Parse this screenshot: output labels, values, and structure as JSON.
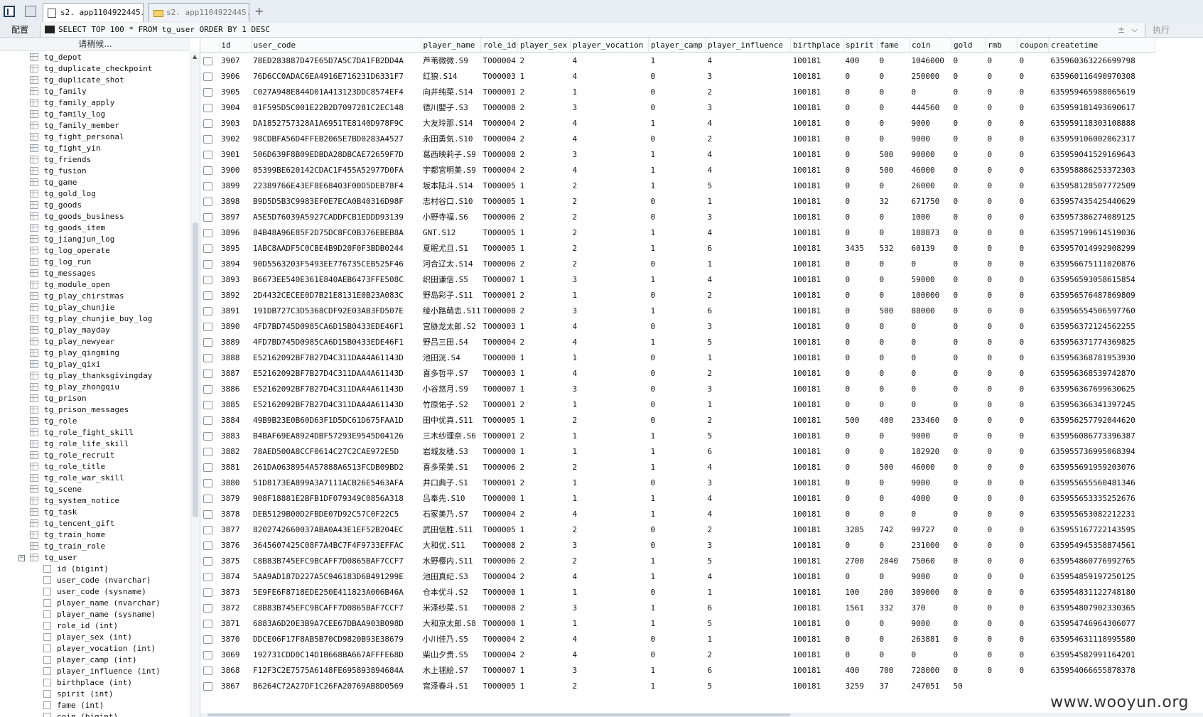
{
  "tabs": [
    {
      "label": "s2. app1104922445. ..."
    },
    {
      "label": "s2. app1104922445. ..."
    }
  ],
  "toolbar": {
    "config_label": "配置",
    "exec_label": "执行",
    "query": "SELECT TOP 100 * FROM tg_user ORDER BY 1 DESC",
    "right_symbol": "±"
  },
  "sidebar": {
    "header": "请稍候...",
    "tables": [
      "tg_depot",
      "tg_duplicate_checkpoint",
      "tg_duplicate_shot",
      "tg_family",
      "tg_family_apply",
      "tg_family_log",
      "tg_family_member",
      "tg_fight_personal",
      "tg_fight_yin",
      "tg_friends",
      "tg_fusion",
      "tg_game",
      "tg_gold_log",
      "tg_goods",
      "tg_goods_business",
      "tg_goods_item",
      "tg_jiangjun_log",
      "tg_log_operate",
      "tg_log_run",
      "tg_messages",
      "tg_module_open",
      "tg_play_chirstmas",
      "tg_play_chunjie",
      "tg_play_chunjie_buy_log",
      "tg_play_mayday",
      "tg_play_newyear",
      "tg_play_qingming",
      "tg_play_qixi",
      "tg_play_thanksgivingday",
      "tg_play_zhongqiu",
      "tg_prison",
      "tg_prison_messages",
      "tg_role",
      "tg_role_fight_skill",
      "tg_role_life_skill",
      "tg_role_recruit",
      "tg_role_title",
      "tg_role_war_skill",
      "tg_scene",
      "tg_system_notice",
      "tg_task",
      "tg_tencent_gift",
      "tg_train_home",
      "tg_train_role"
    ],
    "expanded_table": "tg_user",
    "expander": "−",
    "columns": [
      "id (bigint)",
      "user_code (nvarchar)",
      "user_code (sysname)",
      "player_name (nvarchar)",
      "player_name (sysname)",
      "role_id (int)",
      "player_sex (int)",
      "player_vocation (int)",
      "player_camp (int)",
      "player_influence (int)",
      "birthplace (int)",
      "spirit (int)",
      "fame (int)",
      "coin (bigint)"
    ]
  },
  "grid": {
    "headers": [
      "id",
      "user_code",
      "player_name",
      "role_id",
      "player_sex",
      "player_vocation",
      "player_camp",
      "player_influence",
      "birthplace",
      "spirit",
      "fame",
      "coin",
      "gold",
      "rmb",
      "coupon",
      "createtime"
    ],
    "rows": [
      [
        "3907",
        "78ED283887D47E65D7A5C7DA1FB2DD4A",
        "芦苇微微.S9",
        "T000004",
        "2",
        "4",
        "1",
        "4",
        "100181",
        "400",
        "0",
        "1046000",
        "0",
        "0",
        "0",
        "635960363226699798"
      ],
      [
        "3906",
        "76D6CC0ADAC6EA4916E716231D6331F7",
        "红狼.S14",
        "T000003",
        "1",
        "4",
        "0",
        "3",
        "100181",
        "0",
        "0",
        "250000",
        "0",
        "0",
        "0",
        "635960116490970308"
      ],
      [
        "3905",
        "C027A948E844D01A413123DDC8574EF4",
        "向井纯菜.S14",
        "T000001",
        "2",
        "1",
        "0",
        "2",
        "100181",
        "0",
        "0",
        "0",
        "0",
        "0",
        "0",
        "635959465988065619"
      ],
      [
        "3904",
        "01F595D5C001E22B2D7097281C2EC148",
        "德川嬰子.S3",
        "T000008",
        "2",
        "3",
        "0",
        "3",
        "100181",
        "0",
        "0",
        "444560",
        "0",
        "0",
        "0",
        "635959181493690617"
      ],
      [
        "3903",
        "DA1852757328A1A6951TE8140D978F9C",
        "大友玲那.S14",
        "T000004",
        "2",
        "4",
        "1",
        "4",
        "100181",
        "0",
        "0",
        "9000",
        "0",
        "0",
        "0",
        "635959118303108888"
      ],
      [
        "3902",
        "98CDBFA56D4FFEB2065E7BD0283A4527",
        "永田勇気.S10",
        "T000004",
        "2",
        "4",
        "0",
        "2",
        "100181",
        "0",
        "0",
        "9000",
        "0",
        "0",
        "0",
        "635959106002062317"
      ],
      [
        "3901",
        "506D639F8B09EDBDA28DBCAE72659F7D",
        "葛西映莉子.S9",
        "T000008",
        "2",
        "3",
        "1",
        "4",
        "100181",
        "0",
        "500",
        "90000",
        "0",
        "0",
        "0",
        "635959041529169643"
      ],
      [
        "3900",
        "05399BE620142CDAC1F455A52977D0FA",
        "宇都宮明美.S9",
        "T000004",
        "2",
        "4",
        "1",
        "4",
        "100181",
        "0",
        "500",
        "46000",
        "0",
        "0",
        "0",
        "635958886253372303"
      ],
      [
        "3899",
        "22389766E43EF8E68403F00D5DEB78F4",
        "坂本陆斗.S14",
        "T000005",
        "1",
        "2",
        "1",
        "5",
        "100181",
        "0",
        "0",
        "26000",
        "0",
        "0",
        "0",
        "635958128507772509"
      ],
      [
        "3898",
        "B9D5D5B3C9983EF0E7ECA0B40316D98F",
        "志村谷口.S10",
        "T000005",
        "1",
        "2",
        "0",
        "1",
        "100181",
        "0",
        "32",
        "671750",
        "0",
        "0",
        "0",
        "635957435425440629"
      ],
      [
        "3897",
        "A5E5D76039A5927CADDFCB1EDDD93139",
        "小野寺福.S6",
        "T000006",
        "2",
        "2",
        "0",
        "3",
        "100181",
        "0",
        "0",
        "1000",
        "0",
        "0",
        "0",
        "635957386274089125"
      ],
      [
        "3896",
        "84B48A96E85F2D75DC8FC0B376EBEB8A",
        "GNT.S12",
        "T000005",
        "1",
        "2",
        "1",
        "4",
        "100181",
        "0",
        "0",
        "188873",
        "0",
        "0",
        "0",
        "635957199614519036"
      ],
      [
        "3895",
        "1ABC8AADF5C0CBE4B9D20F0F3BDB0244",
        "夏眠尤且.S1",
        "T000005",
        "1",
        "2",
        "1",
        "6",
        "100181",
        "3435",
        "532",
        "60139",
        "0",
        "0",
        "0",
        "635957014992908299"
      ],
      [
        "3894",
        "90D5563203F5493EE776735CEB525F46",
        "河合辽太.S14",
        "T000006",
        "2",
        "2",
        "0",
        "1",
        "100181",
        "0",
        "0",
        "0",
        "0",
        "0",
        "0",
        "635956675111020876"
      ],
      [
        "3893",
        "B6673EE540E361E840AEB6473FFE508C",
        "织田谦信.S5",
        "T000007",
        "1",
        "3",
        "1",
        "4",
        "100181",
        "0",
        "0",
        "59000",
        "0",
        "0",
        "0",
        "635956593058615854"
      ],
      [
        "3892",
        "2D4432CECEE0D7B21E8131E0B23A083C",
        "野岛彩子.S11",
        "T000001",
        "2",
        "1",
        "0",
        "2",
        "100181",
        "0",
        "0",
        "100000",
        "0",
        "0",
        "0",
        "635956576487869809"
      ],
      [
        "3891",
        "191DB727C3D5368CDF92E03AB3FD507E",
        "绫小路萌恋.S11",
        "T000008",
        "2",
        "3",
        "1",
        "6",
        "100181",
        "0",
        "500",
        "88000",
        "0",
        "0",
        "0",
        "635956554506597760"
      ],
      [
        "3890",
        "4FD7BD745D0985CA6D15B0433EDE46F1",
        "宫胁龙太郎.S2",
        "T000003",
        "1",
        "4",
        "0",
        "3",
        "100181",
        "0",
        "0",
        "0",
        "0",
        "0",
        "0",
        "635956372124562255"
      ],
      [
        "3889",
        "4FD7BD745D0985CA6D15B0433EDE46F1",
        "野吕三田.S4",
        "T000004",
        "2",
        "4",
        "1",
        "5",
        "100181",
        "0",
        "0",
        "0",
        "0",
        "0",
        "0",
        "635956371774369825"
      ],
      [
        "3888",
        "E52162092BF7B27D4C311DAA4A61143D",
        "池田洸.S4",
        "T000000",
        "1",
        "1",
        "0",
        "1",
        "100181",
        "0",
        "0",
        "0",
        "0",
        "0",
        "0",
        "635956368781953930"
      ],
      [
        "3887",
        "E52162092BF7B27D4C311DAA4A61143D",
        "喜多哲平.S7",
        "T000003",
        "1",
        "4",
        "0",
        "2",
        "100181",
        "0",
        "0",
        "0",
        "0",
        "0",
        "0",
        "635956368539742870"
      ],
      [
        "3886",
        "E52162092BF7B27D4C311DAA4A61143D",
        "小谷悠月.S9",
        "T000007",
        "1",
        "3",
        "0",
        "3",
        "100181",
        "0",
        "0",
        "0",
        "0",
        "0",
        "0",
        "635956367699630625"
      ],
      [
        "3885",
        "E52162092BF7B27D4C311DAA4A61143D",
        "竹原佑子.S2",
        "T000001",
        "2",
        "1",
        "0",
        "1",
        "100181",
        "0",
        "0",
        "0",
        "0",
        "0",
        "0",
        "635956366341397245"
      ],
      [
        "3884",
        "49B9B23E0B60D63F1D5DC61D675FAA1D",
        "田中优真.S11",
        "T000005",
        "1",
        "2",
        "0",
        "2",
        "100181",
        "500",
        "400",
        "233460",
        "0",
        "0",
        "0",
        "635956257792044620"
      ],
      [
        "3883",
        "B4BAF69EA8924DBF57293E9545D04126",
        "三木纱理奈.S6",
        "T000001",
        "2",
        "1",
        "1",
        "5",
        "100181",
        "0",
        "0",
        "9000",
        "0",
        "0",
        "0",
        "635956086773396387"
      ],
      [
        "3882",
        "78AED500A8CCF0614C27C2CAE972E5D",
        "岩城友穗.S3",
        "T000000",
        "1",
        "1",
        "1",
        "6",
        "100181",
        "0",
        "0",
        "182920",
        "0",
        "0",
        "0",
        "635955736995068394"
      ],
      [
        "3881",
        "261DA0638954A57888A6513FCDB09BD2",
        "喜多荣美.S1",
        "T000006",
        "2",
        "2",
        "1",
        "4",
        "100181",
        "0",
        "500",
        "46000",
        "0",
        "0",
        "0",
        "635955691959203076"
      ],
      [
        "3880",
        "51D8173EA899A3A7111ACB26E5463AFA",
        "井口典子.S1",
        "T000001",
        "2",
        "1",
        "0",
        "3",
        "100181",
        "0",
        "0",
        "9000",
        "0",
        "0",
        "0",
        "635955655560481346"
      ],
      [
        "3879",
        "908F18881E2BFB1DF079349C0856A318",
        "吕奉先.S10",
        "T000000",
        "1",
        "1",
        "1",
        "4",
        "100181",
        "0",
        "0",
        "4000",
        "0",
        "0",
        "0",
        "635955653335252676"
      ],
      [
        "3878",
        "DEB5129B00D2FBDE07D92C57C0F22C5",
        "石冢美乃.S7",
        "T000004",
        "2",
        "4",
        "1",
        "4",
        "100181",
        "0",
        "0",
        "0",
        "0",
        "0",
        "0",
        "635955653082212231"
      ],
      [
        "3877",
        "8202742660037ABA0A43E1EF52B204EC",
        "武田信胜.S11",
        "T000005",
        "1",
        "2",
        "0",
        "2",
        "100181",
        "3285",
        "742",
        "90727",
        "0",
        "0",
        "0",
        "635955167722143595"
      ],
      [
        "3876",
        "3645607425C08F7A4BC7F4F9733EFFAC",
        "大和优.S11",
        "T000008",
        "2",
        "3",
        "0",
        "3",
        "100181",
        "0",
        "0",
        "231000",
        "0",
        "0",
        "0",
        "635954945358874561"
      ],
      [
        "3875",
        "C8B83B745EFC9BCAFF7D0865BAF7CCF7",
        "水野樱内.S11",
        "T000006",
        "2",
        "2",
        "1",
        "5",
        "100181",
        "2700",
        "2040",
        "75060",
        "0",
        "0",
        "0",
        "635954860776992765"
      ],
      [
        "3874",
        "5AA9AD187D227A5C946183D6B491299E",
        "池田真纪.S3",
        "T000004",
        "2",
        "4",
        "1",
        "4",
        "100181",
        "0",
        "0",
        "9000",
        "0",
        "0",
        "0",
        "635954859197250125"
      ],
      [
        "3873",
        "5E9FE6F8718EDE250E411823A006B46A",
        "仓本优斗.S2",
        "T000000",
        "1",
        "1",
        "0",
        "1",
        "100181",
        "100",
        "200",
        "309000",
        "0",
        "0",
        "0",
        "635954831122748180"
      ],
      [
        "3872",
        "C8B83B745EFC9BCAFF7D0865BAF7CCF7",
        "米泽纱菜.S1",
        "T000008",
        "2",
        "3",
        "1",
        "6",
        "100181",
        "1561",
        "332",
        "370",
        "0",
        "0",
        "0",
        "635954807902330365"
      ],
      [
        "3871",
        "6883A6D20E3B9A7CEE67DBAA903B098D",
        "大和京太郎.S8",
        "T000000",
        "1",
        "1",
        "1",
        "5",
        "100181",
        "0",
        "0",
        "9000",
        "0",
        "0",
        "0",
        "635954746964306077"
      ],
      [
        "3870",
        "DDCE06F17F8AB5B70CD9820B93E38679",
        "小川佳乃.S5",
        "T000004",
        "2",
        "4",
        "0",
        "1",
        "100181",
        "0",
        "0",
        "263881",
        "0",
        "0",
        "0",
        "635954631118995580"
      ],
      [
        "3069",
        "192731CDD0C14D1B668BA667AFFFE68D",
        "柴山夕贵.S5",
        "T000004",
        "2",
        "4",
        "0",
        "2",
        "100181",
        "0",
        "0",
        "0",
        "0",
        "0",
        "0",
        "635954582991164201"
      ],
      [
        "3868",
        "F12F3C2E7575A6148FE695893894684A",
        "水上毬絵.S7",
        "T000007",
        "1",
        "3",
        "1",
        "6",
        "100181",
        "400",
        "700",
        "728000",
        "0",
        "0",
        "0",
        "635954066655878378"
      ],
      [
        "3867",
        "B6264C72A27DF1C26FA20769AB8D0569",
        "宫泽春斗.S1",
        "T000005",
        "1",
        "2",
        "1",
        "5",
        "100181",
        "3259",
        "37",
        "247051",
        "50",
        "",
        "",
        " "
      ]
    ]
  },
  "watermark": "www.wooyun.org"
}
